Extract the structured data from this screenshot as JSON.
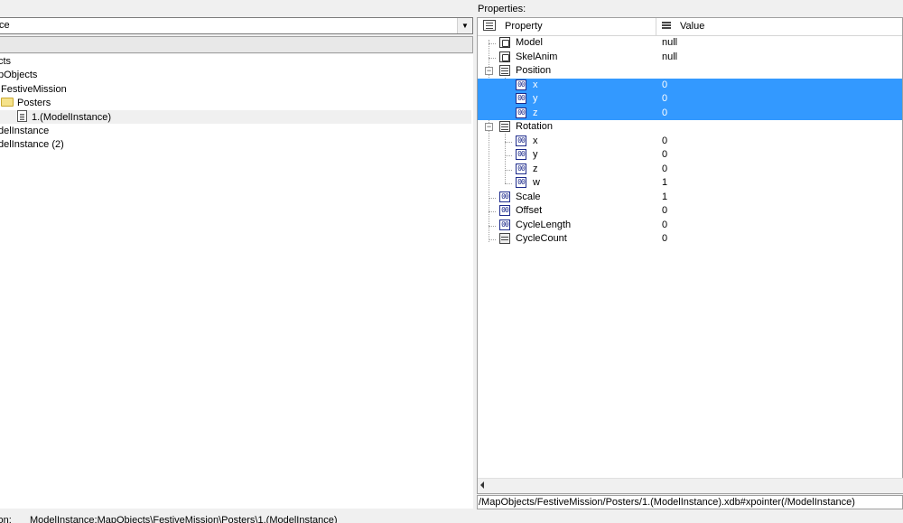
{
  "left_pane": {
    "combo_value": "ce",
    "tree": [
      {
        "label": "cts"
      },
      {
        "label": "pObjects"
      },
      {
        "label": "FestiveMission"
      },
      {
        "label": "Posters"
      },
      {
        "label": "1.(ModelInstance)"
      },
      {
        "label": "delInstance"
      },
      {
        "label": "delInstance (2)"
      }
    ]
  },
  "right_pane": {
    "title": "Properties:",
    "columns": {
      "property": "Property",
      "value": "Value"
    },
    "rows": [
      {
        "name": "Model",
        "value": "null",
        "icon": "object-icon"
      },
      {
        "name": "SkelAnim",
        "value": "null",
        "icon": "object-icon"
      },
      {
        "name": "Position",
        "value": "",
        "icon": "struct-icon"
      },
      {
        "name": "x",
        "value": "0",
        "icon": "number-icon"
      },
      {
        "name": "y",
        "value": "0",
        "icon": "number-icon"
      },
      {
        "name": "z",
        "value": "0",
        "icon": "number-icon"
      },
      {
        "name": "Rotation",
        "value": "",
        "icon": "struct-icon"
      },
      {
        "name": "x",
        "value": "0",
        "icon": "number-icon"
      },
      {
        "name": "y",
        "value": "0",
        "icon": "number-icon"
      },
      {
        "name": "z",
        "value": "0",
        "icon": "number-icon"
      },
      {
        "name": "w",
        "value": "1",
        "icon": "number-icon"
      },
      {
        "name": "Scale",
        "value": "1",
        "icon": "number-icon"
      },
      {
        "name": "Offset",
        "value": "0",
        "icon": "number-icon"
      },
      {
        "name": "CycleLength",
        "value": "0",
        "icon": "number-icon"
      },
      {
        "name": "CycleCount",
        "value": "0",
        "icon": "grid-icon"
      }
    ],
    "path": "/MapObjects/FestiveMission/Posters/1.(ModelInstance).xdb#xpointer(/ModelInstance)"
  },
  "status": {
    "label": "tion:",
    "value": "ModelInstance:MapObjects\\FestiveMission\\Posters\\1.(ModelInstance)"
  },
  "colors": {
    "selection": "#3399ff",
    "icon_blue": "#1d2b8c"
  }
}
